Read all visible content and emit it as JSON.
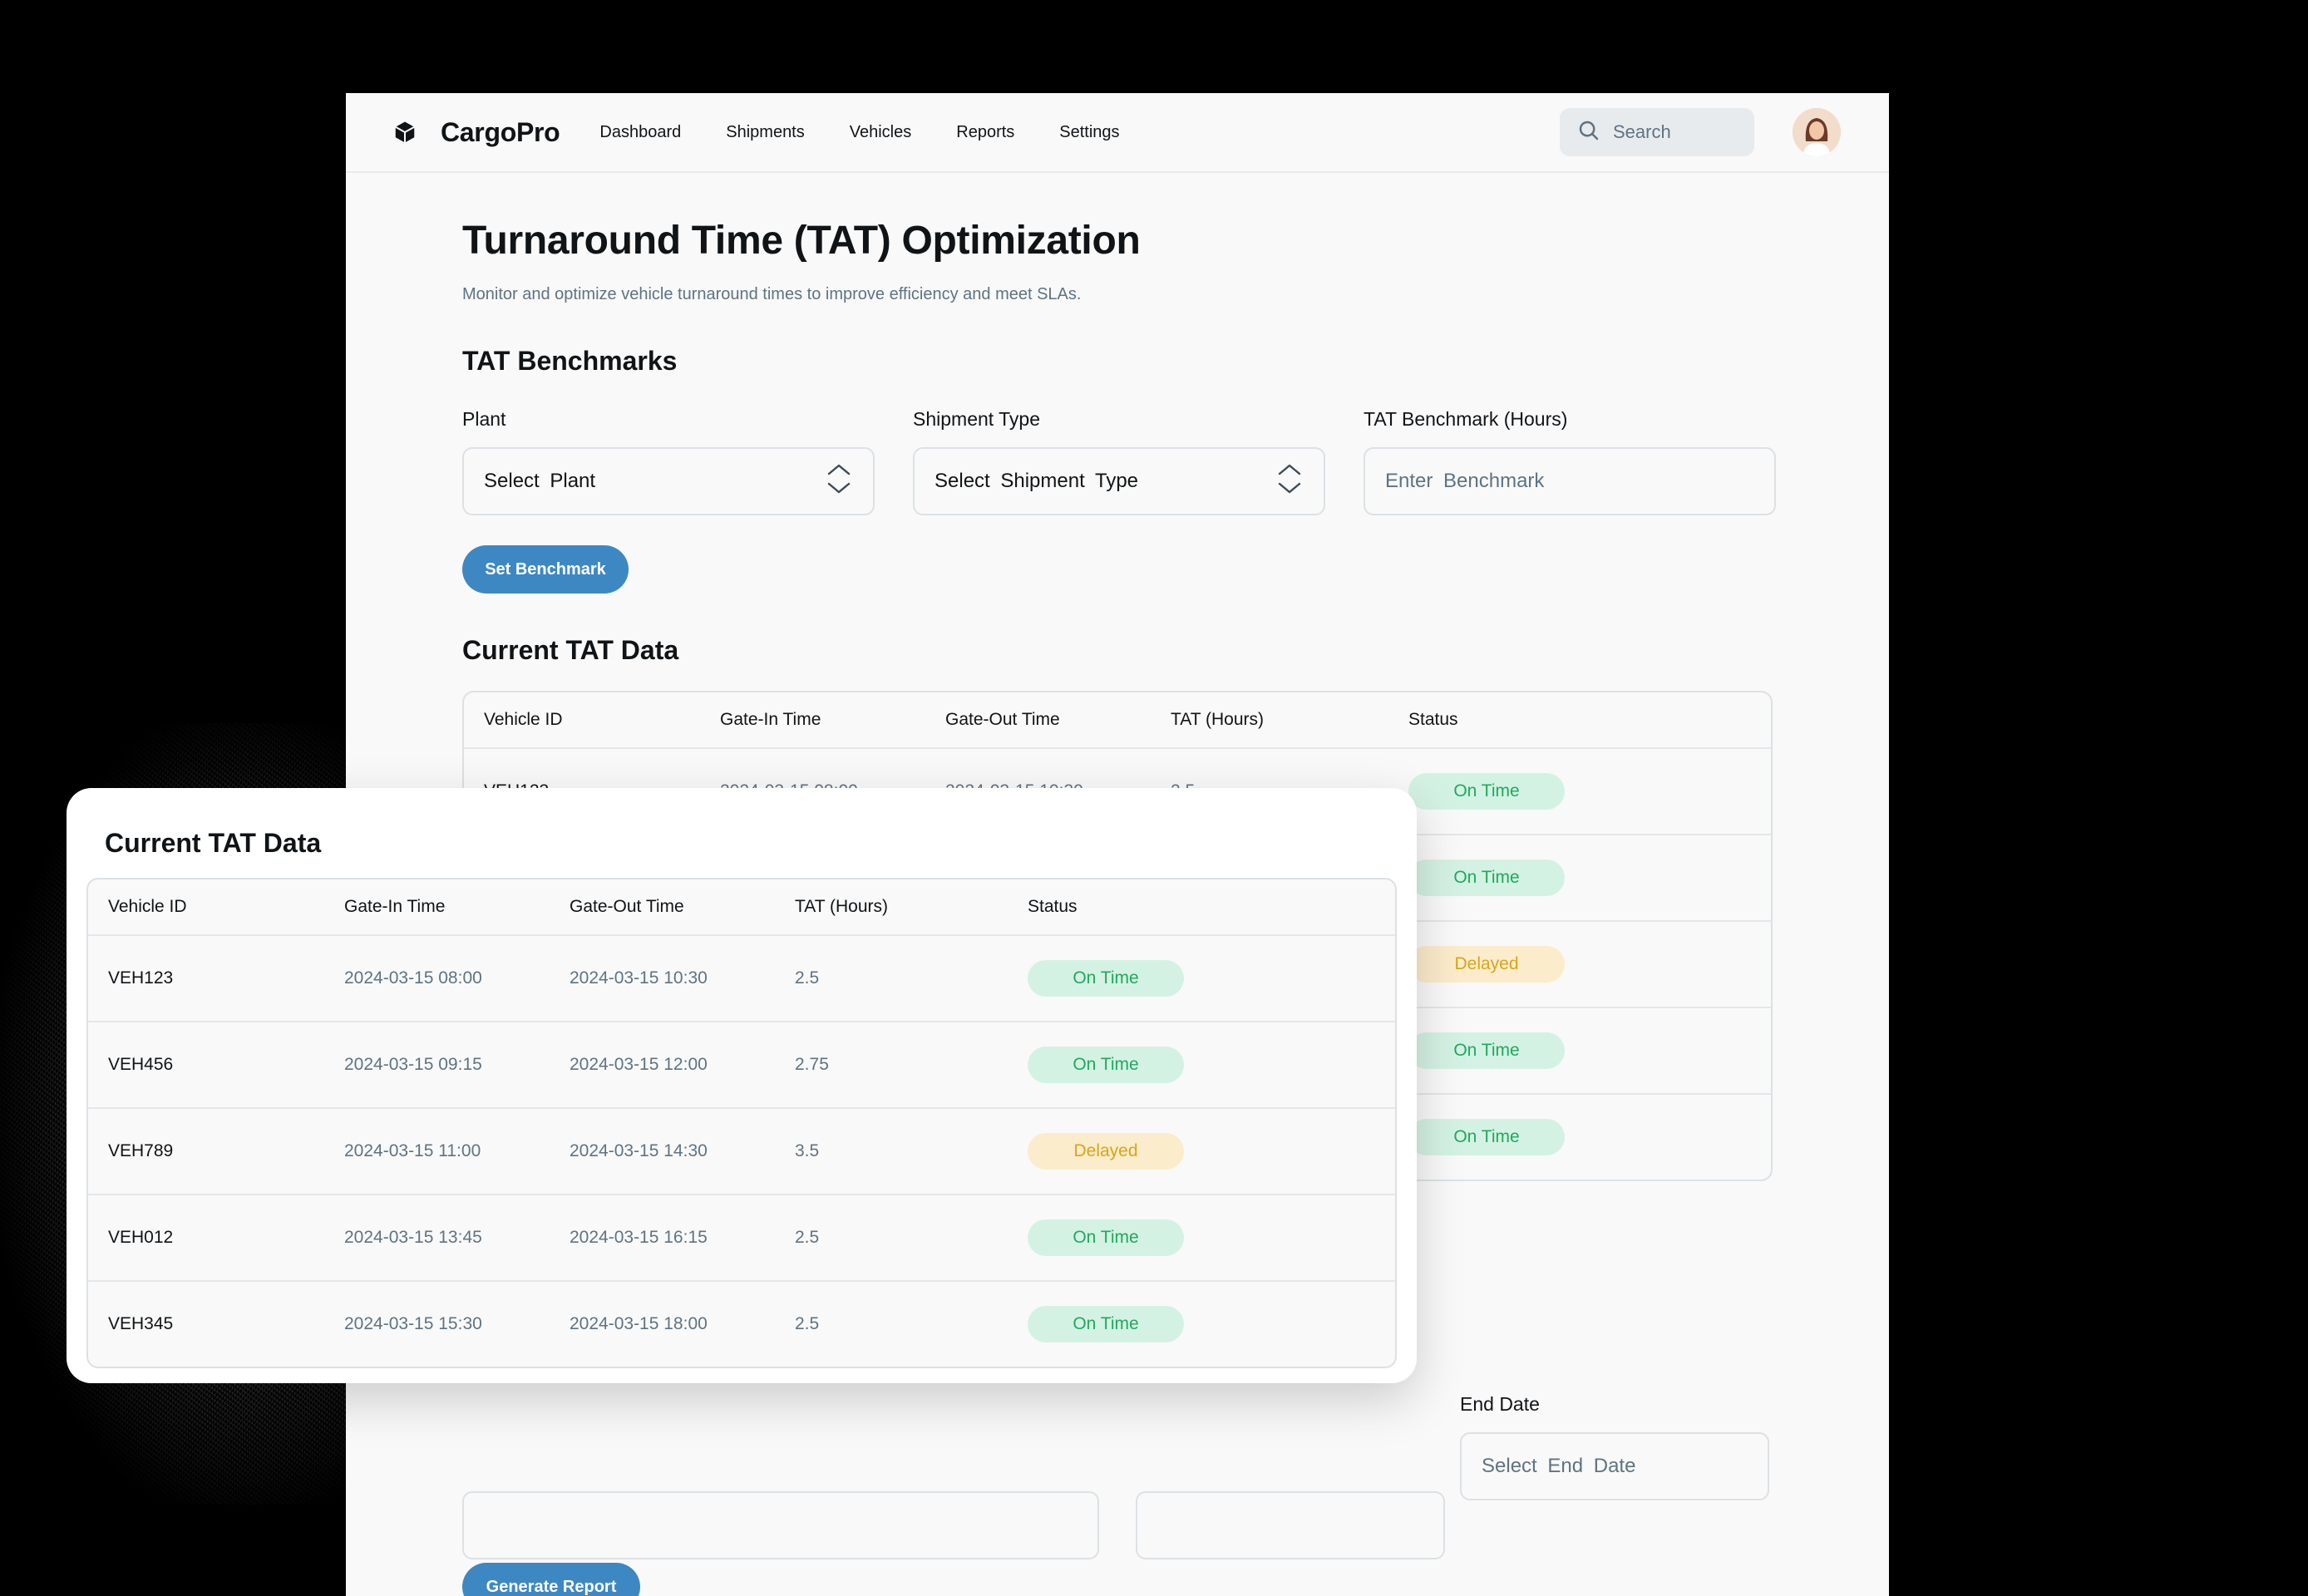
{
  "app": {
    "brand": "CargoPro",
    "nav": [
      "Dashboard",
      "Shipments",
      "Vehicles",
      "Reports",
      "Settings"
    ],
    "search_placeholder": "Search"
  },
  "page": {
    "title": "Turnaround Time (TAT) Optimization",
    "subtitle": "Monitor and optimize vehicle turnaround times to improve efficiency and meet SLAs."
  },
  "benchmarks": {
    "title": "TAT Benchmarks",
    "plant_label": "Plant",
    "plant_value": "Select Plant",
    "shipment_label": "Shipment Type",
    "shipment_value": "Select Shipment Type",
    "benchmark_label": "TAT Benchmark (Hours)",
    "benchmark_placeholder": "Enter Benchmark",
    "button": "Set Benchmark"
  },
  "tat": {
    "title": "Current TAT Data",
    "columns": [
      "Vehicle ID",
      "Gate-In Time",
      "Gate-Out Time",
      "TAT (Hours)",
      "Status"
    ],
    "rows": [
      {
        "id": "VEH123",
        "in": "2024-03-15 08:00",
        "out": "2024-03-15 10:30",
        "tat": "2.5",
        "status": "On Time",
        "kind": "ok"
      },
      {
        "id": "VEH456",
        "in": "2024-03-15 09:15",
        "out": "2024-03-15 12:00",
        "tat": "2.75",
        "status": "On Time",
        "kind": "ok"
      },
      {
        "id": "VEH789",
        "in": "2024-03-15 11:00",
        "out": "2024-03-15 14:30",
        "tat": "3.5",
        "status": "Delayed",
        "kind": "late"
      },
      {
        "id": "VEH012",
        "in": "2024-03-15 13:45",
        "out": "2024-03-15 16:15",
        "tat": "2.5",
        "status": "On Time",
        "kind": "ok"
      },
      {
        "id": "VEH345",
        "in": "2024-03-15 15:30",
        "out": "2024-03-15 18:00",
        "tat": "2.5",
        "status": "On Time",
        "kind": "ok"
      }
    ]
  },
  "report": {
    "end_date_label": "End Date",
    "end_date_placeholder": "Select End Date",
    "button": "Generate Report"
  },
  "colors": {
    "accent": "#3d88c3",
    "on_time_bg": "#d4f2e3",
    "on_time_text": "#1faa5e",
    "delayed_bg": "#fbeccb",
    "delayed_text": "#d8a51a"
  }
}
